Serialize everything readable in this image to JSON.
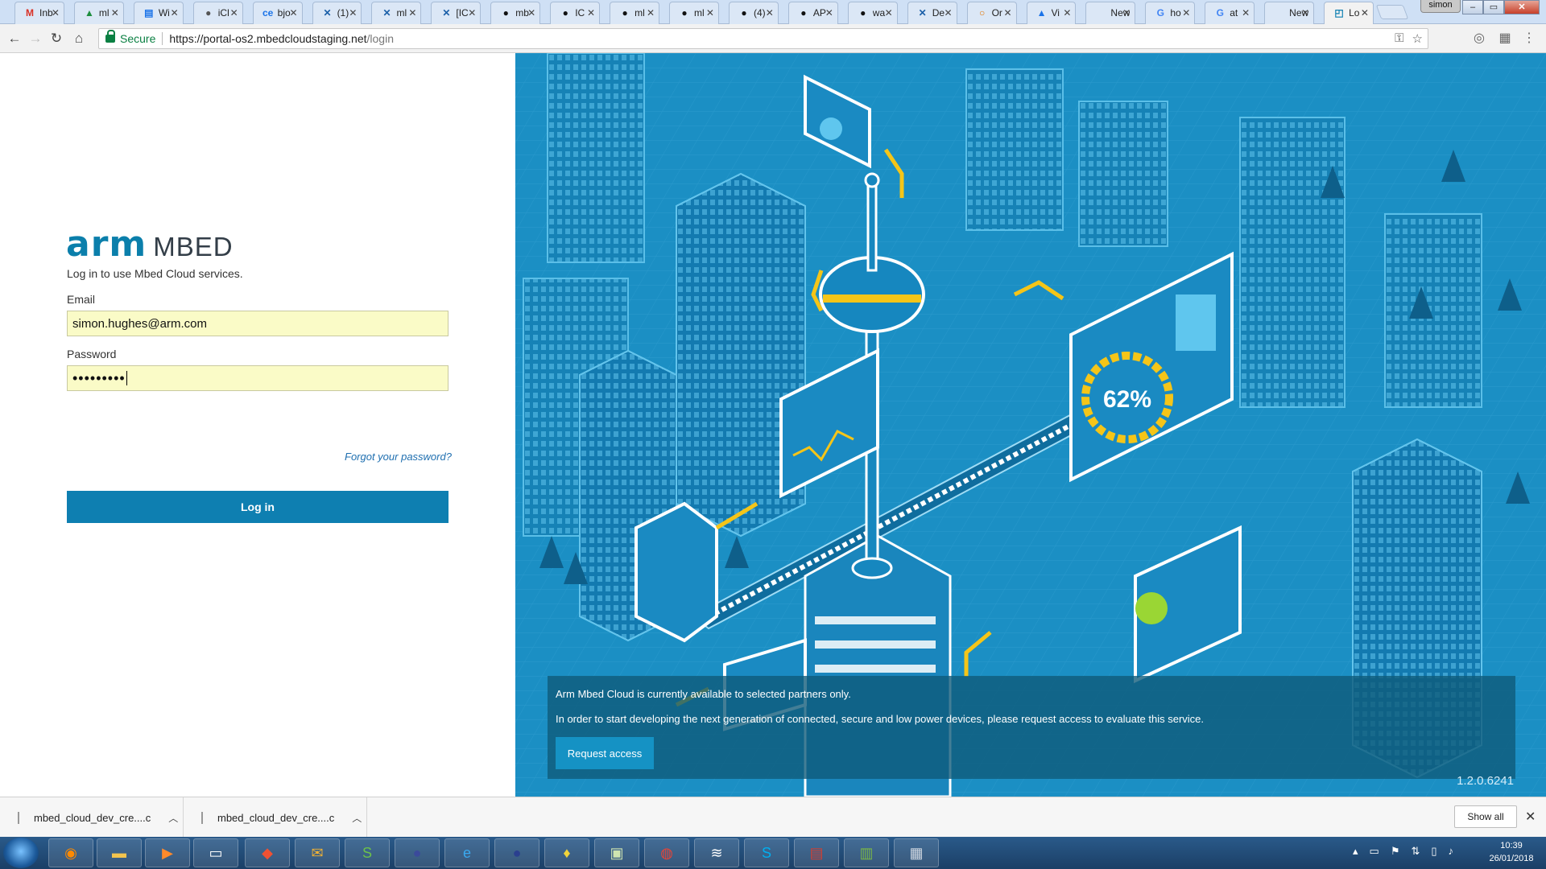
{
  "browser": {
    "tabs": [
      {
        "icon": "M",
        "title": "Inb",
        "color": "#d93025"
      },
      {
        "icon": "▲",
        "title": "ml",
        "color": "#1e8e3e"
      },
      {
        "icon": "▤",
        "title": "Wi",
        "color": "#1a73e8"
      },
      {
        "icon": "●",
        "title": "iCl",
        "color": "#555"
      },
      {
        "icon": "ce",
        "title": "bjo",
        "color": "#1a73e8"
      },
      {
        "icon": "✕",
        "title": "(1)",
        "color": "#1a5fa8"
      },
      {
        "icon": "✕",
        "title": "ml",
        "color": "#1a5fa8"
      },
      {
        "icon": "✕",
        "title": "[IC",
        "color": "#1a5fa8"
      },
      {
        "icon": "●",
        "title": "mb",
        "color": "#111"
      },
      {
        "icon": "●",
        "title": "IC",
        "color": "#111"
      },
      {
        "icon": "●",
        "title": "ml",
        "color": "#111"
      },
      {
        "icon": "●",
        "title": "ml",
        "color": "#111"
      },
      {
        "icon": "●",
        "title": "(4)",
        "color": "#111"
      },
      {
        "icon": "●",
        "title": "AP",
        "color": "#111"
      },
      {
        "icon": "●",
        "title": "wa",
        "color": "#111"
      },
      {
        "icon": "✕",
        "title": "De",
        "color": "#1a5fa8"
      },
      {
        "icon": "○",
        "title": "Or",
        "color": "#e37400"
      },
      {
        "icon": "▲",
        "title": "Vi",
        "color": "#1a73e8"
      },
      {
        "icon": "",
        "title": "New T",
        "color": "#555"
      },
      {
        "icon": "G",
        "title": "ho",
        "color": "#4285f4"
      },
      {
        "icon": "G",
        "title": "at",
        "color": "#4285f4"
      },
      {
        "icon": "",
        "title": "New T",
        "color": "#555"
      },
      {
        "icon": "◰",
        "title": "Lo",
        "color": "#0e7fb1"
      }
    ],
    "profile": "simon",
    "secure_label": "Secure",
    "url_host": "https://portal-os2.mbedcloudstaging.net",
    "url_path": "/login"
  },
  "login": {
    "logo_arm": "arm",
    "logo_mbed": "MBED",
    "tagline": "Log in to use Mbed Cloud services.",
    "email_label": "Email",
    "email_value": "simon.hughes@arm.com",
    "password_label": "Password",
    "password_value": "•••••••••",
    "forgot_link": "Forgot your password?",
    "login_button": "Log in"
  },
  "illustration": {
    "gauge_text": "62%",
    "notice_line1": "Arm Mbed Cloud is currently available to selected partners only.",
    "notice_line2": "In order to start developing the next generation of connected, secure and low power devices, please request access to evaluate this service.",
    "request_button": "Request access",
    "version": "1.2.0.6241"
  },
  "downloads": {
    "items": [
      {
        "name": "mbed_cloud_dev_cre....c"
      },
      {
        "name": "mbed_cloud_dev_cre....c"
      }
    ],
    "show_all": "Show all"
  },
  "taskbar": {
    "time": "10:39",
    "date": "26/01/2018"
  },
  "colors": {
    "accent": "#0e7fb1",
    "illustration_bg": "#1b8fc4",
    "autofill": "#fafbc7",
    "highlight": "#f5c518"
  }
}
